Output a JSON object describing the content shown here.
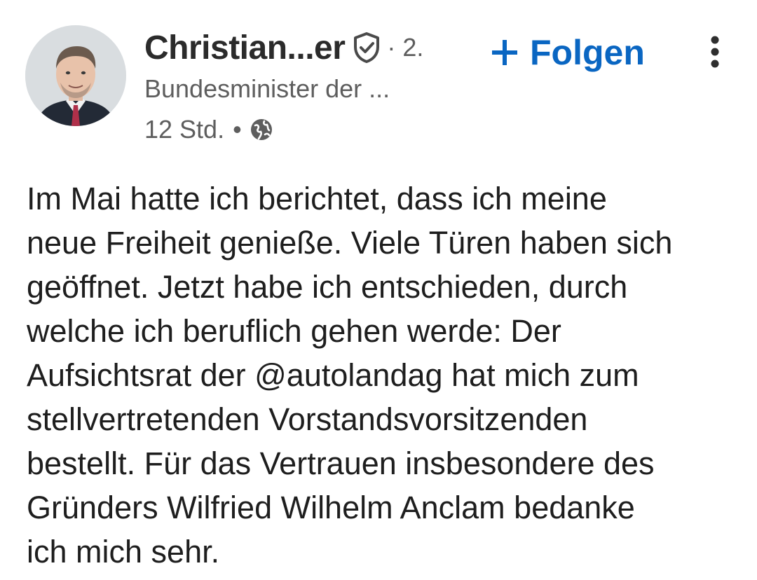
{
  "post": {
    "author": {
      "name": "Christian...er",
      "verified_icon": "verified-shield-check-icon",
      "connection_degree": "· 2.",
      "headline": "Bundesminister der ...",
      "timestamp": "12 Std.",
      "visibility_separator": "•",
      "visibility_icon": "globe-icon",
      "avatar_icon": "profile-photo"
    },
    "actions": {
      "follow_label": "Folgen",
      "follow_icon": "plus-icon",
      "more_icon": "three-dots-vertical-icon"
    },
    "body_text": "Im Mai hatte ich berichtet, dass ich meine\nneue Freiheit genieße. Viele Türen haben sich\ngeöffnet. Jetzt habe ich entschieden, durch\nwelche ich beruflich gehen werde: Der\nAufsichtsrat der @autolandag hat mich zum\nstellvertretenden Vorstandsvorsitzenden\nbestellt. Für das Vertrauen insbesondere des\nGründers Wilfried Wilhelm Anclam bedanke\nich mich sehr."
  },
  "colors": {
    "accent": "#0a66c2",
    "primary_text": "#1e1e1e",
    "secondary_text": "#5e5e5e",
    "background": "#ffffff"
  }
}
